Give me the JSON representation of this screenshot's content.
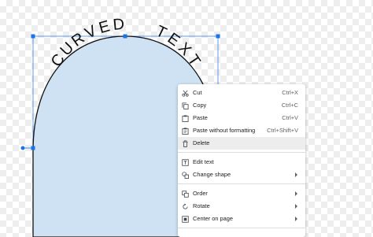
{
  "canvas": {
    "curved_text": "CURVED  TEXT",
    "shape_fill": "#cfe2f3",
    "selection_color": "#1a73e8"
  },
  "context_menu": {
    "items": [
      {
        "label": "Cut",
        "shortcut": "Ctrl+X",
        "icon": "scissors-icon"
      },
      {
        "label": "Copy",
        "shortcut": "Ctrl+C",
        "icon": "copy-icon"
      },
      {
        "label": "Paste",
        "shortcut": "Ctrl+V",
        "icon": "paste-icon"
      },
      {
        "label": "Paste without formatting",
        "shortcut": "Ctrl+Shift+V",
        "icon": "paste-plain-icon"
      },
      {
        "label": "Delete",
        "shortcut": "",
        "icon": "trash-icon"
      },
      {
        "label": "Edit text",
        "shortcut": "",
        "icon": "text-box-icon"
      },
      {
        "label": "Change shape",
        "shortcut": "",
        "icon": "shapes-icon"
      },
      {
        "label": "Order",
        "shortcut": "",
        "icon": "order-icon"
      },
      {
        "label": "Rotate",
        "shortcut": "",
        "icon": "rotate-icon"
      },
      {
        "label": "Center on page",
        "shortcut": "",
        "icon": "center-icon"
      }
    ],
    "highlighted_item": "Delete"
  }
}
